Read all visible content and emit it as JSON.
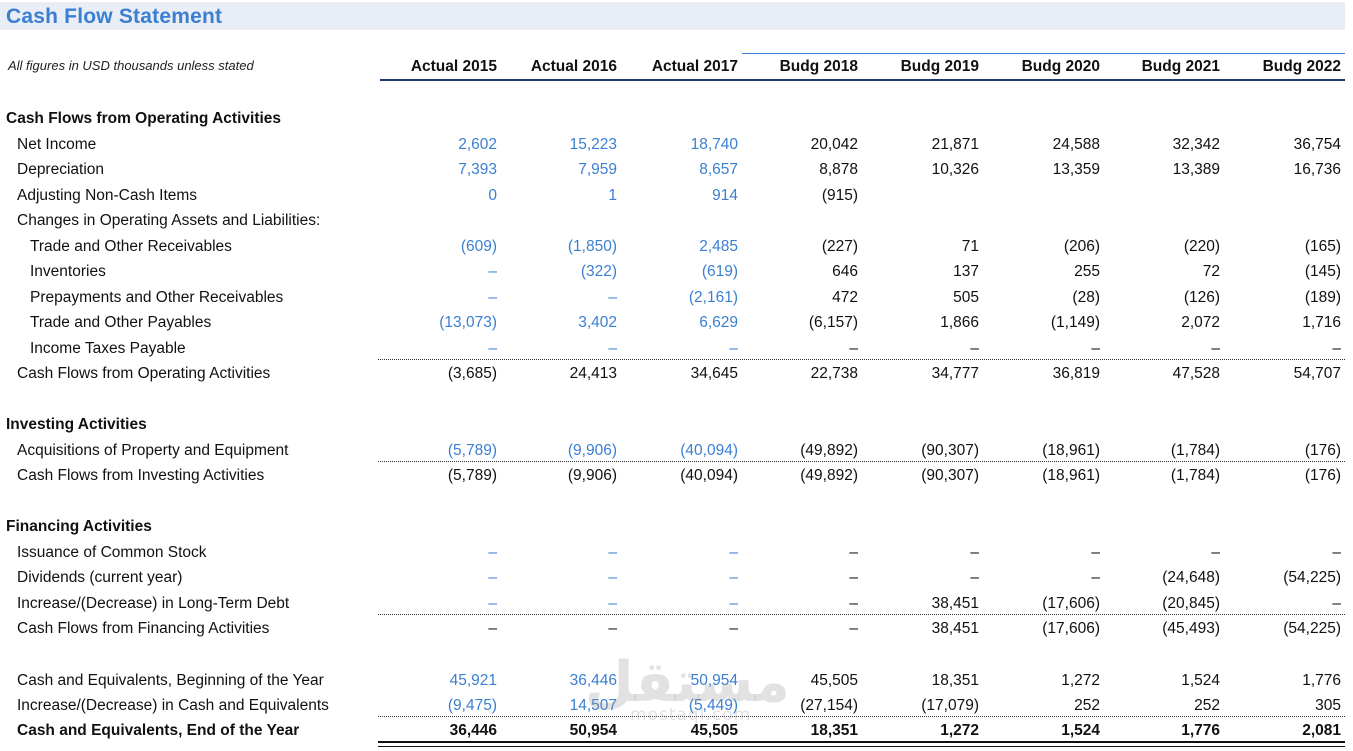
{
  "title": "Cash Flow Statement",
  "note": "All figures in USD thousands unless stated",
  "columns": [
    "Actual 2015",
    "Actual 2016",
    "Actual 2017",
    "Budg 2018",
    "Budg 2019",
    "Budg 2020",
    "Budg 2021",
    "Budg 2022"
  ],
  "colors": {
    "actual": "#3b7fd2",
    "title": "#3b7fd2",
    "title_bg": "#e8edf6"
  },
  "sections": {
    "operating": "Cash Flows from Operating Activities",
    "investing": "Investing Activities",
    "financing": "Financing Activities"
  },
  "rows": [
    {
      "label": "Net Income",
      "values": [
        "2,602",
        "15,223",
        "18,740",
        "20,042",
        "21,871",
        "24,588",
        "32,342",
        "36,754"
      ]
    },
    {
      "label": "Depreciation",
      "values": [
        "7,393",
        "7,959",
        "8,657",
        "8,878",
        "10,326",
        "13,359",
        "13,389",
        "16,736"
      ]
    },
    {
      "label": "Adjusting Non-Cash Items",
      "values": [
        "0",
        "1",
        "914",
        "(915)",
        "",
        "",
        "",
        ""
      ]
    },
    {
      "label": "Changes in Operating Assets and Liabilities:",
      "values": [
        "",
        "",
        "",
        "",
        "",
        "",
        "",
        ""
      ]
    },
    {
      "label": "Trade and Other Receivables",
      "values": [
        "(609)",
        "(1,850)",
        "2,485",
        "(227)",
        "71",
        "(206)",
        "(220)",
        "(165)"
      ]
    },
    {
      "label": "Inventories",
      "values": [
        "–",
        "(322)",
        "(619)",
        "646",
        "137",
        "255",
        "72",
        "(145)"
      ]
    },
    {
      "label": "Prepayments and Other Receivables",
      "values": [
        "–",
        "–",
        "(2,161)",
        "472",
        "505",
        "(28)",
        "(126)",
        "(189)"
      ]
    },
    {
      "label": "Trade and Other Payables",
      "values": [
        "(13,073)",
        "3,402",
        "6,629",
        "(6,157)",
        "1,866",
        "(1,149)",
        "2,072",
        "1,716"
      ]
    },
    {
      "label": "Income Taxes Payable",
      "values": [
        "–",
        "–",
        "–",
        "–",
        "–",
        "–",
        "–",
        "–"
      ]
    },
    {
      "label": "Cash Flows from Operating Activities",
      "values": [
        "(3,685)",
        "24,413",
        "34,645",
        "22,738",
        "34,777",
        "36,819",
        "47,528",
        "54,707"
      ]
    },
    {
      "label": "Acquisitions of Property and Equipment",
      "values": [
        "(5,789)",
        "(9,906)",
        "(40,094)",
        "(49,892)",
        "(90,307)",
        "(18,961)",
        "(1,784)",
        "(176)"
      ]
    },
    {
      "label": "Cash Flows from Investing Activities",
      "values": [
        "(5,789)",
        "(9,906)",
        "(40,094)",
        "(49,892)",
        "(90,307)",
        "(18,961)",
        "(1,784)",
        "(176)"
      ]
    },
    {
      "label": "Issuance of Common Stock",
      "values": [
        "–",
        "–",
        "–",
        "–",
        "–",
        "–",
        "–",
        "–"
      ]
    },
    {
      "label": "Dividends (current year)",
      "values": [
        "–",
        "–",
        "–",
        "–",
        "–",
        "–",
        "(24,648)",
        "(54,225)"
      ]
    },
    {
      "label": "Increase/(Decrease) in Long-Term Debt",
      "values": [
        "–",
        "–",
        "–",
        "–",
        "38,451",
        "(17,606)",
        "(20,845)",
        "–"
      ]
    },
    {
      "label": "Cash Flows from Financing Activities",
      "values": [
        "–",
        "–",
        "–",
        "–",
        "38,451",
        "(17,606)",
        "(45,493)",
        "(54,225)"
      ]
    },
    {
      "label": "Cash and Equivalents, Beginning of the Year",
      "values": [
        "45,921",
        "36,446",
        "50,954",
        "45,505",
        "18,351",
        "1,272",
        "1,524",
        "1,776"
      ]
    },
    {
      "label": "Increase/(Decrease) in Cash and Equivalents",
      "values": [
        "(9,475)",
        "14,507",
        "(5,449)",
        "(27,154)",
        "(17,079)",
        "252",
        "252",
        "305"
      ]
    },
    {
      "label": "Cash and Equivalents, End of the Year",
      "values": [
        "36,446",
        "50,954",
        "45,505",
        "18,351",
        "1,272",
        "1,524",
        "1,776",
        "2,081"
      ]
    }
  ],
  "watermark": {
    "text": "مستقل",
    "sub": "mostaql.com"
  }
}
